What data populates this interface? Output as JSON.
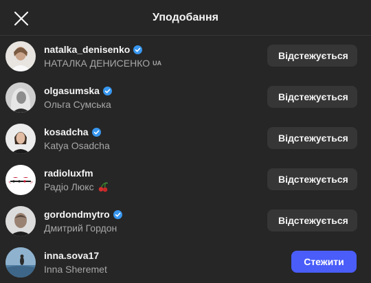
{
  "header": {
    "title": "Уподобання"
  },
  "colors": {
    "background": "#262626",
    "button_following": "#363636",
    "button_follow": "#4a5df9",
    "verified": "#3897f0"
  },
  "users": [
    {
      "username": "natalka_denisenko",
      "full_name": "НАТАЛКА ДЕНИСЕНКО",
      "suffix": "UA",
      "verified": true,
      "button": "Відстежується"
    },
    {
      "username": "olgasumska",
      "full_name": "Ольга Сумська",
      "verified": true,
      "button": "Відстежується"
    },
    {
      "username": "kosadcha",
      "full_name": "Katya Osadcha",
      "verified": true,
      "button": "Відстежується"
    },
    {
      "username": "radioluxfm",
      "full_name": "Радіо Люкс",
      "suffix_icon": "cherries-emoji",
      "verified": false,
      "button": "Відстежується"
    },
    {
      "username": "gordondmytro",
      "full_name": "Дмитрий Гордон",
      "verified": true,
      "button": "Відстежується"
    },
    {
      "username": "inna.sova17",
      "full_name": "Inna Sheremet",
      "verified": false,
      "button": "Стежити"
    }
  ]
}
